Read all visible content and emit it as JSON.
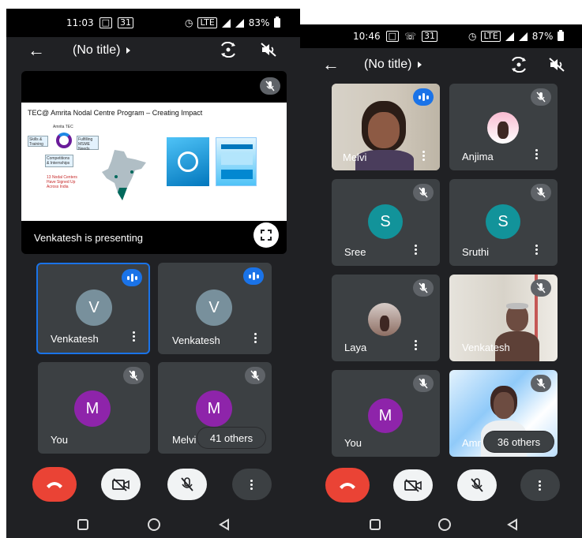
{
  "left": {
    "status": {
      "time": "11:03",
      "battery": "83%"
    },
    "title": "(No title)",
    "presentation": {
      "slide_title": "TEC@ Amrita Nodal Centre Program – Creating Impact",
      "slide_org": "Amrita TEC",
      "slide_box1": "Skills & Training",
      "slide_box2": "Fulfilling MSME Needs",
      "slide_box3": "Competitions & Internships",
      "slide_note": "13 Nodal Centers Have Signed Up Across India",
      "caption": "Venkatesh is presenting"
    },
    "tiles": [
      {
        "name": "Venkatesh",
        "initial": "V",
        "color": "#78909c",
        "state": "speaking"
      },
      {
        "name": "Venkatesh",
        "initial": "V",
        "color": "#78909c",
        "state": "speaking"
      },
      {
        "name": "You",
        "initial": "M",
        "color": "#8e24aa",
        "state": "muted"
      },
      {
        "name": "Melvi",
        "initial": "M",
        "color": "#8e24aa",
        "state": "muted"
      }
    ],
    "others_label": "41 others"
  },
  "right": {
    "status": {
      "time": "10:46",
      "battery": "87%"
    },
    "title": "(No title)",
    "tiles": [
      {
        "name": "Melvi",
        "initial": "",
        "state": "speaking"
      },
      {
        "name": "Anjima",
        "initial": "",
        "state": "muted"
      },
      {
        "name": "Sree",
        "initial": "S",
        "color": "#12939a",
        "state": "muted"
      },
      {
        "name": "Sruthi",
        "initial": "S",
        "color": "#12939a",
        "state": "muted"
      },
      {
        "name": "Laya",
        "initial": "",
        "state": "muted"
      },
      {
        "name": "Venkatesh",
        "initial": "",
        "state": "muted"
      },
      {
        "name": "You",
        "initial": "M",
        "color": "#8e24aa",
        "state": "muted"
      },
      {
        "name": "Amr",
        "initial": "",
        "state": "muted"
      }
    ],
    "others_label": "36 others"
  },
  "icons": {
    "back": "back-arrow-icon",
    "dropdown": "triangle-right-icon",
    "switch_camera": "switch-camera-icon",
    "speaker_off": "speaker-off-icon",
    "mic_off": "mic-off-icon",
    "speaking": "audio-level-icon",
    "end_call": "end-call-icon",
    "camera_off": "camera-off-icon",
    "more": "more-vert-icon",
    "fullscreen": "fullscreen-icon"
  },
  "colors": {
    "background": "#202124",
    "tile": "#3c4043",
    "end_call": "#ea4335",
    "accent": "#1a73e8"
  }
}
